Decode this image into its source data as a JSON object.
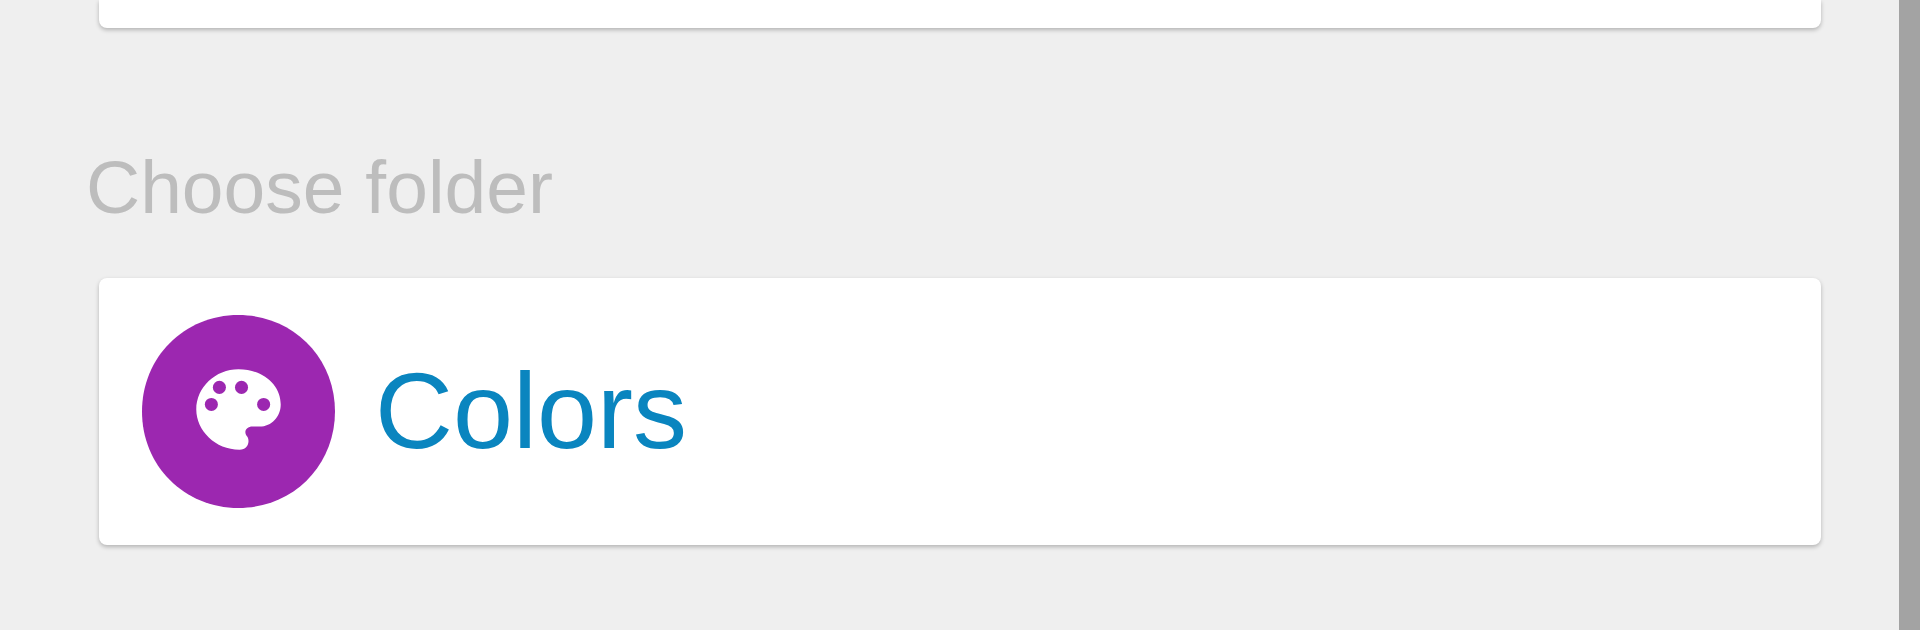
{
  "section": {
    "title": "Choose folder"
  },
  "items": [
    {
      "label": "Colors",
      "color": "#9c27b0"
    }
  ]
}
